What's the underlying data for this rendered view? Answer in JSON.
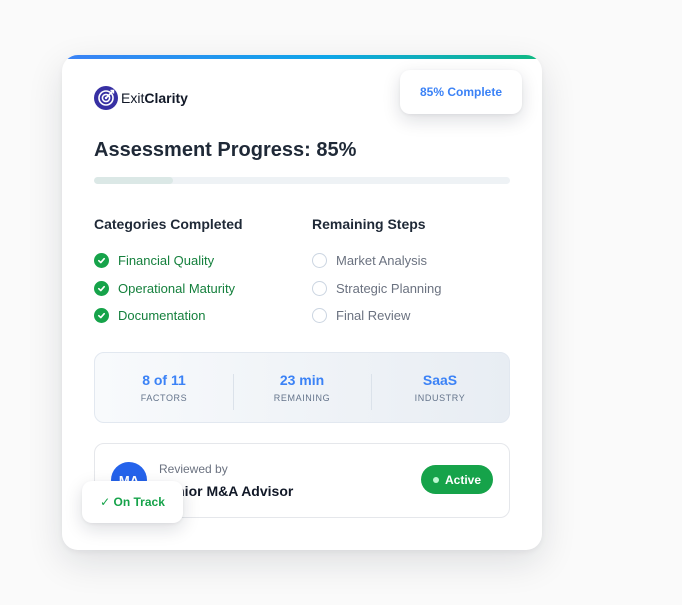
{
  "brand": {
    "prefix": "Exit",
    "name": "Clarity"
  },
  "floating": {
    "complete_label": "85% Complete",
    "on_track_label": "✓ On Track"
  },
  "assessment": {
    "title": "Assessment Progress: 85%",
    "progress": 0.19
  },
  "categories_completed": {
    "title": "Categories Completed",
    "items": [
      "Financial Quality",
      "Operational Maturity",
      "Documentation"
    ]
  },
  "remaining_steps": {
    "title": "Remaining Steps",
    "items": [
      "Market Analysis",
      "Strategic Planning",
      "Final Review"
    ]
  },
  "stats": [
    {
      "value": "8 of 11",
      "label": "FACTORS"
    },
    {
      "value": "23 min",
      "label": "REMAINING"
    },
    {
      "value": "SaaS",
      "label": "INDUSTRY"
    }
  ],
  "reviewer": {
    "label": "Reviewed by",
    "name": "Senior M&A Advisor",
    "initials": "MA",
    "status": "Active"
  },
  "colors": {
    "accent": "#3b82f6",
    "success": "#16a34a",
    "brand": "#3730a3"
  }
}
